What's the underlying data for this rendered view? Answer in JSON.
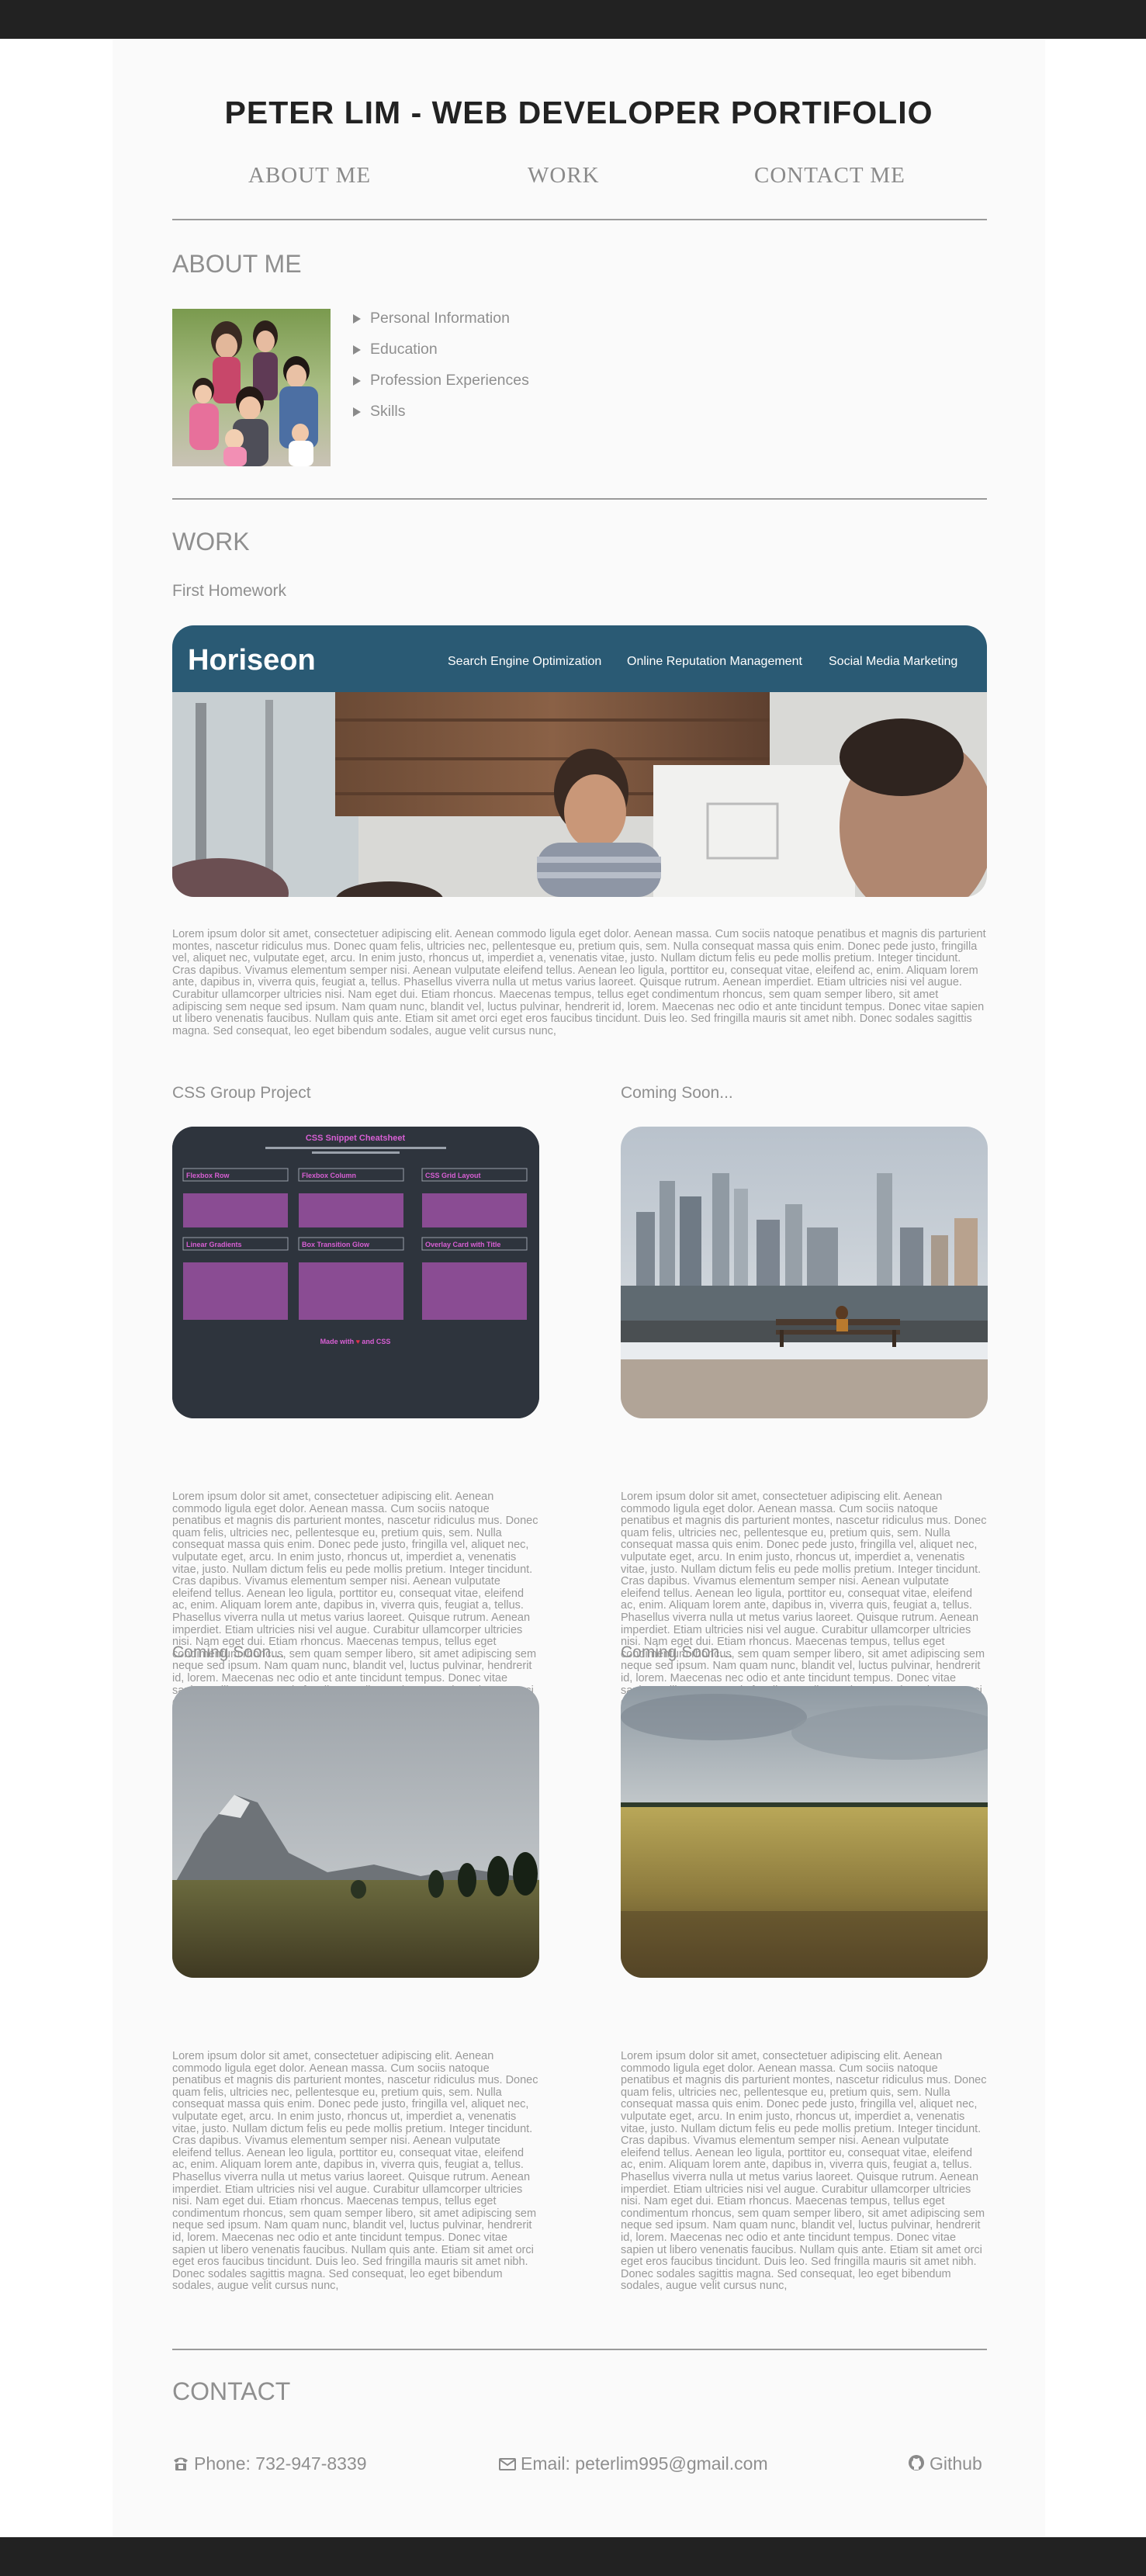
{
  "header": {
    "title": "PETER LIM - WEB DEVELOPER PORTIFOLIO"
  },
  "nav": {
    "items": [
      {
        "label": "ABOUT ME"
      },
      {
        "label": "WORK"
      },
      {
        "label": "CONTACT ME"
      }
    ]
  },
  "about": {
    "heading": "ABOUT ME",
    "items": [
      {
        "label": "Personal Information"
      },
      {
        "label": "Education"
      },
      {
        "label": "Profession Experiences"
      },
      {
        "label": "Skills"
      }
    ]
  },
  "work": {
    "heading": "WORK",
    "featured": {
      "title": "First Homework",
      "brand": "Horiseon",
      "brand_nav": [
        "Search Engine Optimization",
        "Online Reputation Management",
        "Social Media Marketing"
      ],
      "description": "Lorem ipsum dolor sit amet, consectetuer adipiscing elit. Aenean commodo ligula eget dolor. Aenean massa. Cum sociis natoque penatibus et magnis dis parturient montes, nascetur ridiculus mus. Donec quam felis, ultricies nec, pellentesque eu, pretium quis, sem. Nulla consequat massa quis enim. Donec pede justo, fringilla vel, aliquet nec, vulputate eget, arcu. In enim justo, rhoncus ut, imperdiet a, venenatis vitae, justo. Nullam dictum felis eu pede mollis pretium. Integer tincidunt. Cras dapibus. Vivamus elementum semper nisi. Aenean vulputate eleifend tellus. Aenean leo ligula, porttitor eu, consequat vitae, eleifend ac, enim. Aliquam lorem ante, dapibus in, viverra quis, feugiat a, tellus. Phasellus viverra nulla ut metus varius laoreet. Quisque rutrum. Aenean imperdiet. Etiam ultricies nisi vel augue. Curabitur ullamcorper ultricies nisi. Nam eget dui. Etiam rhoncus. Maecenas tempus, tellus eget condimentum rhoncus, sem quam semper libero, sit amet adipiscing sem neque sed ipsum. Nam quam nunc, blandit vel, luctus pulvinar, hendrerit id, lorem. Maecenas nec odio et ante tincidunt tempus. Donec vitae sapien ut libero venenatis faucibus. Nullam quis ante. Etiam sit amet orci eget eros faucibus tincidunt. Duis leo. Sed fringilla mauris sit amet nibh. Donec sodales sagittis magna. Sed consequat, leo eget bibendum sodales, augue velit cursus nunc,"
    },
    "projects": [
      {
        "title": "CSS Group Project",
        "cheatsheet_title": "CSS Snippet Cheatsheet",
        "cheatsheet_cards": [
          "Flexbox Row",
          "Flexbox Column",
          "CSS Grid Layout",
          "Linear Gradients",
          "Box Transition Glow",
          "Overlay Card with Title"
        ],
        "cheatsheet_footer": "Made with ♥ and CSS",
        "description": "Lorem ipsum dolor sit amet, consectetuer adipiscing elit. Aenean commodo ligula eget dolor. Aenean massa. Cum sociis natoque penatibus et magnis dis parturient montes, nascetur ridiculus mus. Donec quam felis, ultricies nec, pellentesque eu, pretium quis, sem. Nulla consequat massa quis enim. Donec pede justo, fringilla vel, aliquet nec, vulputate eget, arcu. In enim justo, rhoncus ut, imperdiet a, venenatis vitae, justo. Nullam dictum felis eu pede mollis pretium. Integer tincidunt. Cras dapibus. Vivamus elementum semper nisi. Aenean vulputate eleifend tellus. Aenean leo ligula, porttitor eu, consequat vitae, eleifend ac, enim. Aliquam lorem ante, dapibus in, viverra quis, feugiat a, tellus. Phasellus viverra nulla ut metus varius laoreet. Quisque rutrum. Aenean imperdiet. Etiam ultricies nisi vel augue. Curabitur ullamcorper ultricies nisi. Nam eget dui. Etiam rhoncus. Maecenas tempus, tellus eget condimentum rhoncus, sem quam semper libero, sit amet adipiscing sem neque sed ipsum. Nam quam nunc, blandit vel, luctus pulvinar, hendrerit id, lorem. Maecenas nec odio et ante tincidunt tempus. Donec vitae sapien ut libero venenatis faucibus. Nullam quis ante. Etiam sit amet orci eget eros faucibus tincidunt. Duis leo. Sed fringilla mauris sit amet nibh. Donec sodales sagittis magna. Sed consequat, leo eget bibendum sodales, augue velit cursus nunc,"
      },
      {
        "title": "Coming Soon...",
        "description": "Lorem ipsum dolor sit amet, consectetuer adipiscing elit. Aenean commodo ligula eget dolor. Aenean massa. Cum sociis natoque penatibus et magnis dis parturient montes, nascetur ridiculus mus. Donec quam felis, ultricies nec, pellentesque eu, pretium quis, sem. Nulla consequat massa quis enim. Donec pede justo, fringilla vel, aliquet nec, vulputate eget, arcu. In enim justo, rhoncus ut, imperdiet a, venenatis vitae, justo. Nullam dictum felis eu pede mollis pretium. Integer tincidunt. Cras dapibus. Vivamus elementum semper nisi. Aenean vulputate eleifend tellus. Aenean leo ligula, porttitor eu, consequat vitae, eleifend ac, enim. Aliquam lorem ante, dapibus in, viverra quis, feugiat a, tellus. Phasellus viverra nulla ut metus varius laoreet. Quisque rutrum. Aenean imperdiet. Etiam ultricies nisi vel augue. Curabitur ullamcorper ultricies nisi. Nam eget dui. Etiam rhoncus. Maecenas tempus, tellus eget condimentum rhoncus, sem quam semper libero, sit amet adipiscing sem neque sed ipsum. Nam quam nunc, blandit vel, luctus pulvinar, hendrerit id, lorem. Maecenas nec odio et ante tincidunt tempus. Donec vitae sapien ut libero venenatis faucibus. Nullam quis ante. Etiam sit amet orci eget eros faucibus tincidunt. Duis leo. Sed fringilla mauris sit amet nibh. Donec sodales sagittis magna. Sed consequat, leo eget bibendum sodales, augue velit cursus nunc,"
      },
      {
        "title": "Coming Soon...",
        "description": "Lorem ipsum dolor sit amet, consectetuer adipiscing elit. Aenean commodo ligula eget dolor. Aenean massa. Cum sociis natoque penatibus et magnis dis parturient montes, nascetur ridiculus mus. Donec quam felis, ultricies nec, pellentesque eu, pretium quis, sem. Nulla consequat massa quis enim. Donec pede justo, fringilla vel, aliquet nec, vulputate eget, arcu. In enim justo, rhoncus ut, imperdiet a, venenatis vitae, justo. Nullam dictum felis eu pede mollis pretium. Integer tincidunt. Cras dapibus. Vivamus elementum semper nisi. Aenean vulputate eleifend tellus. Aenean leo ligula, porttitor eu, consequat vitae, eleifend ac, enim. Aliquam lorem ante, dapibus in, viverra quis, feugiat a, tellus. Phasellus viverra nulla ut metus varius laoreet. Quisque rutrum. Aenean imperdiet. Etiam ultricies nisi vel augue. Curabitur ullamcorper ultricies nisi. Nam eget dui. Etiam rhoncus. Maecenas tempus, tellus eget condimentum rhoncus, sem quam semper libero, sit amet adipiscing sem neque sed ipsum. Nam quam nunc, blandit vel, luctus pulvinar, hendrerit id, lorem. Maecenas nec odio et ante tincidunt tempus. Donec vitae sapien ut libero venenatis faucibus. Nullam quis ante. Etiam sit amet orci eget eros faucibus tincidunt. Duis leo. Sed fringilla mauris sit amet nibh. Donec sodales sagittis magna. Sed consequat, leo eget bibendum sodales, augue velit cursus nunc,"
      },
      {
        "title": "Coming Soon...",
        "description": "Lorem ipsum dolor sit amet, consectetuer adipiscing elit. Aenean commodo ligula eget dolor. Aenean massa. Cum sociis natoque penatibus et magnis dis parturient montes, nascetur ridiculus mus. Donec quam felis, ultricies nec, pellentesque eu, pretium quis, sem. Nulla consequat massa quis enim. Donec pede justo, fringilla vel, aliquet nec, vulputate eget, arcu. In enim justo, rhoncus ut, imperdiet a, venenatis vitae, justo. Nullam dictum felis eu pede mollis pretium. Integer tincidunt. Cras dapibus. Vivamus elementum semper nisi. Aenean vulputate eleifend tellus. Aenean leo ligula, porttitor eu, consequat vitae, eleifend ac, enim. Aliquam lorem ante, dapibus in, viverra quis, feugiat a, tellus. Phasellus viverra nulla ut metus varius laoreet. Quisque rutrum. Aenean imperdiet. Etiam ultricies nisi vel augue. Curabitur ullamcorper ultricies nisi. Nam eget dui. Etiam rhoncus. Maecenas tempus, tellus eget condimentum rhoncus, sem quam semper libero, sit amet adipiscing sem neque sed ipsum. Nam quam nunc, blandit vel, luctus pulvinar, hendrerit id, lorem. Maecenas nec odio et ante tincidunt tempus. Donec vitae sapien ut libero venenatis faucibus. Nullam quis ante. Etiam sit amet orci eget eros faucibus tincidunt. Duis leo. Sed fringilla mauris sit amet nibh. Donec sodales sagittis magna. Sed consequat, leo eget bibendum sodales, augue velit cursus nunc,"
      }
    ]
  },
  "contact": {
    "heading": "CONTACT",
    "phone": "Phone: 732-947-8339",
    "email": "Email: peterlim995@gmail.com",
    "github": "Github"
  },
  "colors": {
    "page_bg": "#fafafa",
    "bars": "#222222",
    "text": "#8f8f8f",
    "horiseon_header": "#2a5a74",
    "cheatsheet_bg": "#2e343d",
    "cheatsheet_accent": "#d85fd4"
  }
}
